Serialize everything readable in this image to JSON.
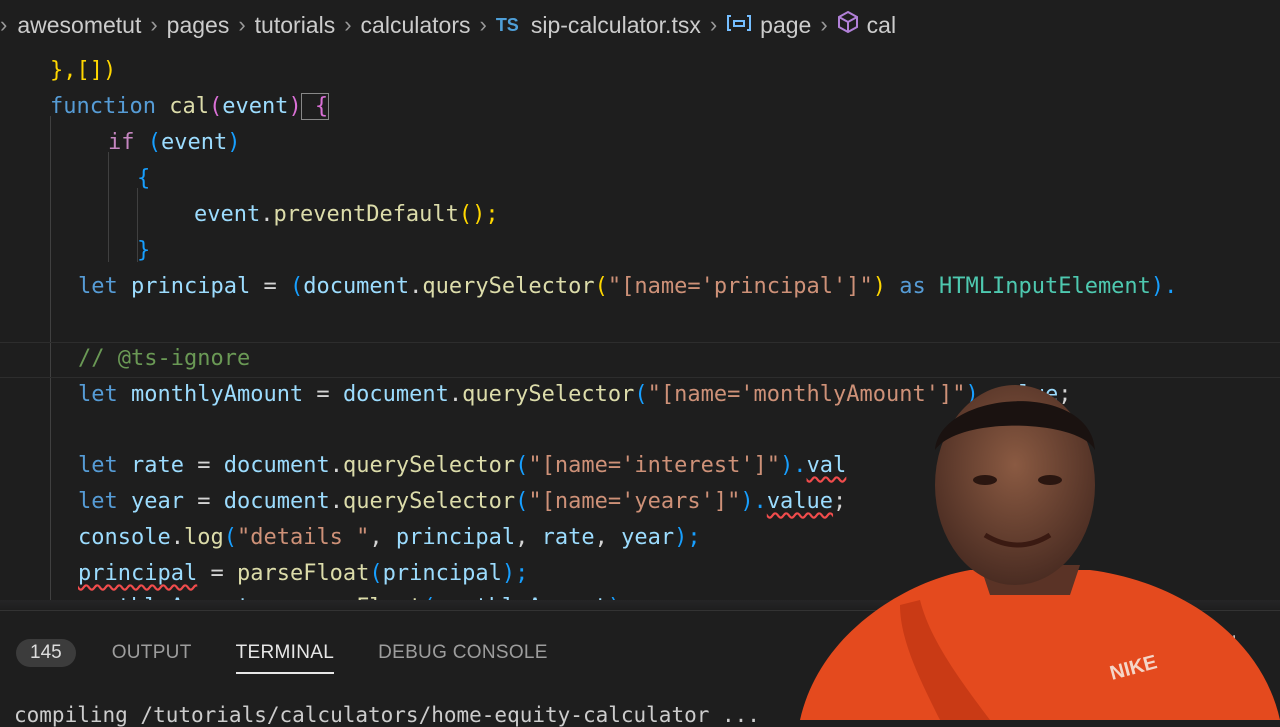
{
  "breadcrumb": {
    "items": [
      "awesometut",
      "pages",
      "tutorials",
      "calculators"
    ],
    "file_badge": "TS",
    "file": "sip-calculator.tsx",
    "symbol1": "page",
    "symbol2": "cal"
  },
  "code": {
    "l1": "},[])",
    "l2": [
      "function",
      " cal",
      "(",
      "event",
      ")",
      " {"
    ],
    "l3": [
      "if",
      " (",
      "event",
      ")"
    ],
    "l4": "{",
    "l5": [
      "event",
      ".",
      "preventDefault",
      "();"
    ],
    "l6": "}",
    "l7": [
      "let",
      " principal",
      " = ",
      "(",
      "document",
      ".",
      "querySelector",
      "(",
      "\"[name='principal']\"",
      ")",
      " as ",
      "HTMLInputElement",
      ")."
    ],
    "l8": "// @ts-ignore",
    "l9": [
      "let",
      " monthlyAmount",
      " = ",
      "document",
      ".",
      "querySelector",
      "(",
      "\"[name='monthlyAmount']\"",
      ").",
      "value",
      ";"
    ],
    "l10": [
      "let",
      " rate",
      " = ",
      "document",
      ".",
      "querySelector",
      "(",
      "\"[name='interest']\"",
      ").",
      "val"
    ],
    "l11": [
      "let",
      " year",
      " = ",
      "document",
      ".",
      "querySelector",
      "(",
      "\"[name='years']\"",
      ").",
      "value",
      ";"
    ],
    "l12": [
      "console",
      ".",
      "log",
      "(",
      "\"details \"",
      ", ",
      "principal",
      ", ",
      "rate",
      ", ",
      "year",
      ");"
    ],
    "l13": [
      "principal",
      " = ",
      "parseFloat",
      "(",
      "principal",
      ");"
    ],
    "l14": [
      "monthlyAmount",
      " = ",
      "parseFloat",
      "(",
      "monthlyAmount",
      ");"
    ]
  },
  "panel": {
    "problem_count": "145",
    "tabs": [
      "OUTPUT",
      "TERMINAL",
      "DEBUG CONSOLE"
    ],
    "active_tab": "TERMINAL",
    "terminal_line": "compiling /tutorials/calculators/home-equity-calculator ..."
  },
  "shirt_text": "NIKE",
  "colors": {
    "editor_bg": "#1e1e1e",
    "keyword": "#569cd6",
    "function": "#dcdcaa",
    "variable": "#9cdcfe",
    "string": "#ce9178",
    "type": "#4ec9b0",
    "comment": "#6a9955"
  }
}
